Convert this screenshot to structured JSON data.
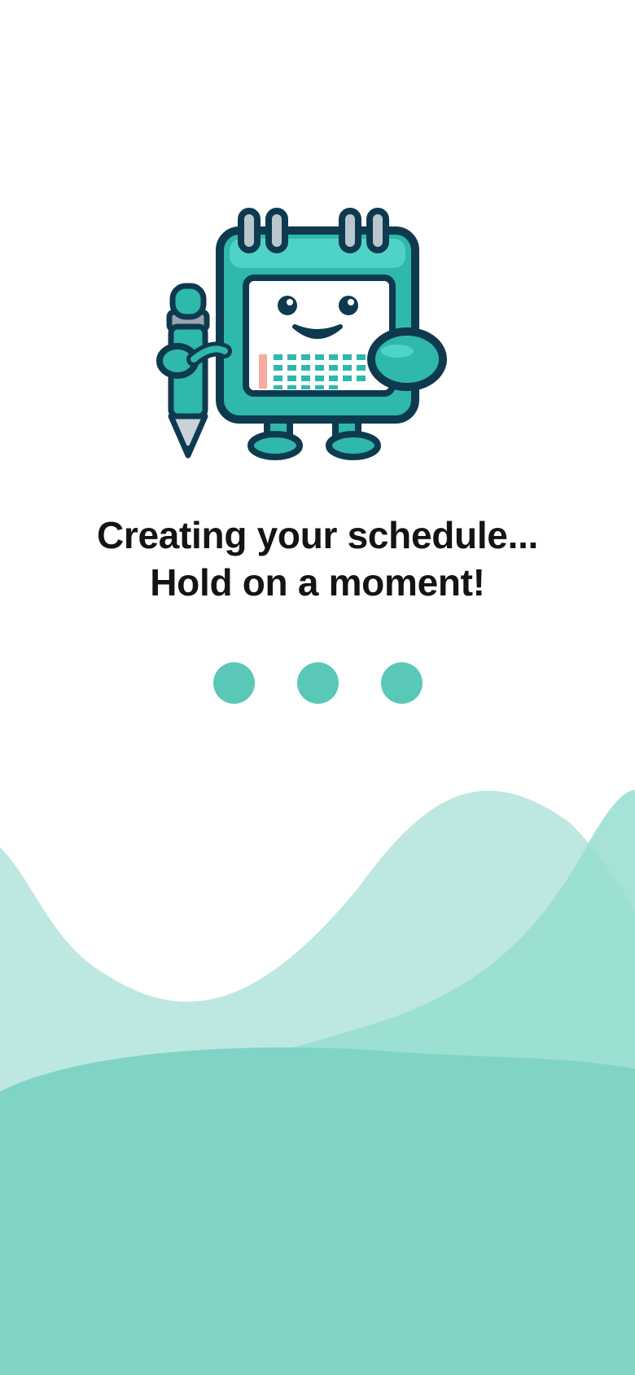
{
  "status": {
    "line1": "Creating your schedule...",
    "line2": "Hold on a moment!"
  },
  "illustration": {
    "name": "calendar-mascot-with-pencil",
    "colors": {
      "body": "#2fb8ac",
      "outline": "#0e3a4f",
      "page": "#ffffff",
      "accent": "#f6aaa0"
    }
  },
  "loader": {
    "dot_count": 3,
    "color": "#5ac8b6"
  },
  "background_waves": {
    "colors": [
      "#bde8e1",
      "#97ddd0",
      "#7fd4c6"
    ]
  }
}
